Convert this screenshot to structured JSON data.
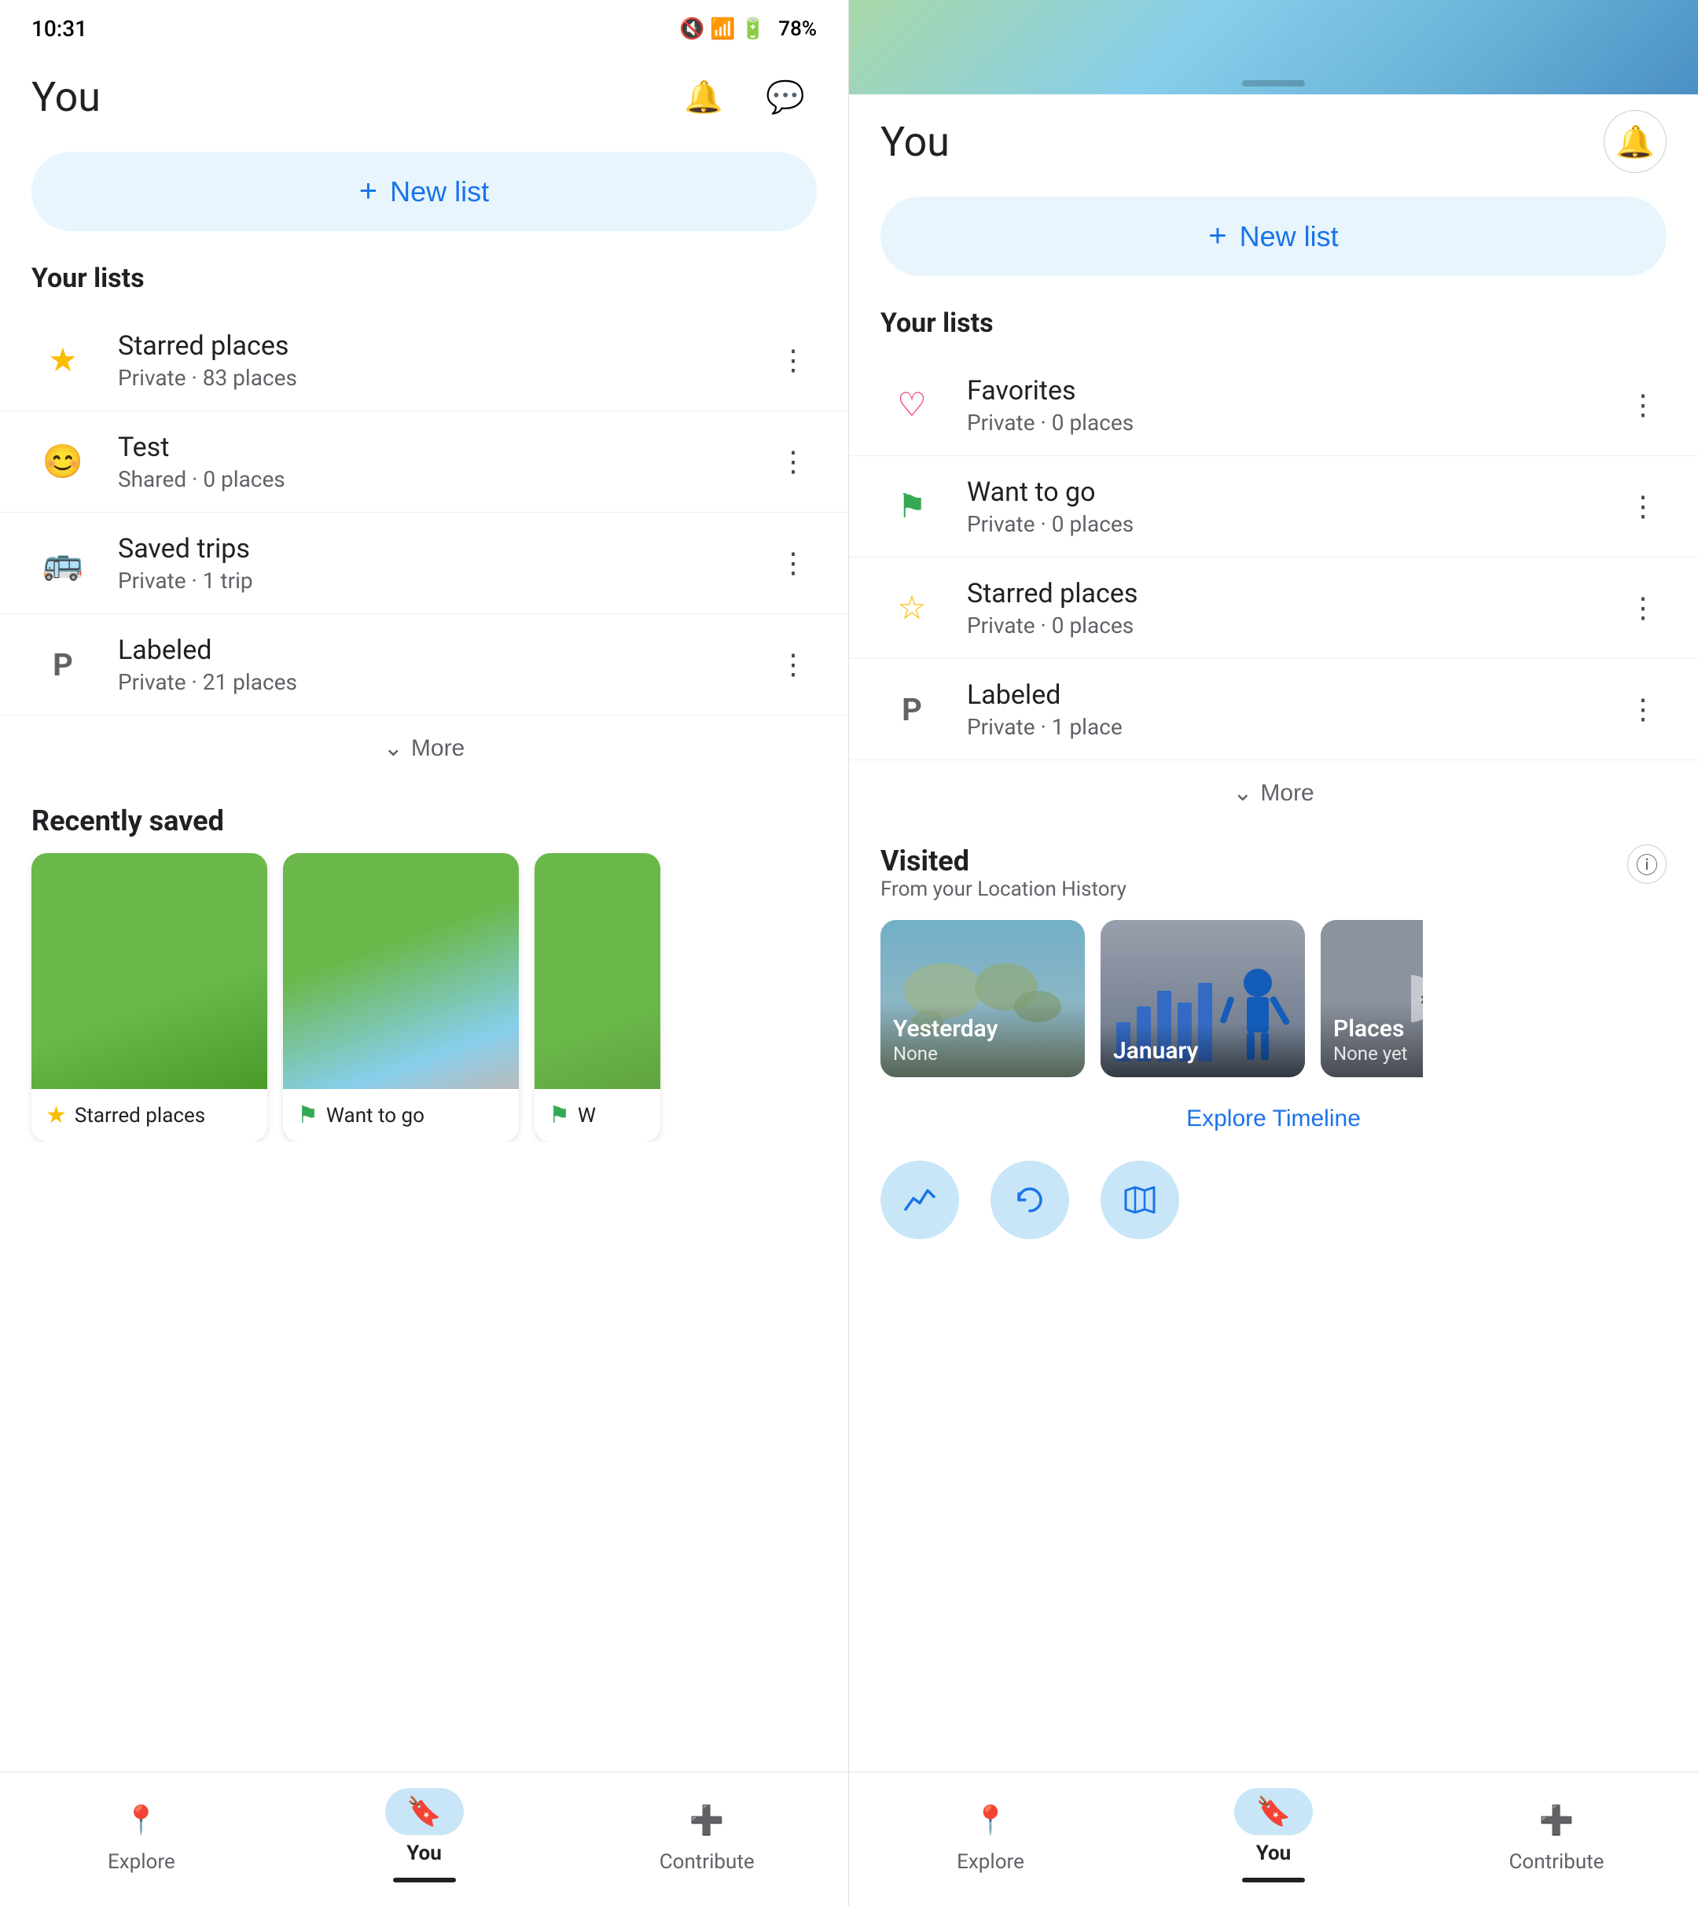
{
  "left": {
    "statusBar": {
      "time": "10:31",
      "battery": "78%"
    },
    "header": {
      "title": "You",
      "notificationIcon": "🔔",
      "messageIcon": "💬"
    },
    "newListBtn": {
      "label": "New list",
      "plusIcon": "+"
    },
    "yourLists": {
      "title": "Your lists",
      "items": [
        {
          "name": "Starred places",
          "sub": "Private · 83 places",
          "iconType": "star"
        },
        {
          "name": "Test",
          "sub": "Shared · 0 places",
          "iconType": "smiley"
        },
        {
          "name": "Saved trips",
          "sub": "Private · 1 trip",
          "iconType": "bus"
        },
        {
          "name": "Labeled",
          "sub": "Private · 21 places",
          "iconType": "label"
        }
      ],
      "moreBtn": "More"
    },
    "recentlySaved": {
      "title": "Recently saved",
      "cards": [
        {
          "label": "Starred places",
          "iconType": "star"
        },
        {
          "label": "Want to go",
          "iconType": "flag"
        },
        {
          "label": "W...",
          "iconType": "flag"
        }
      ]
    },
    "bottomNav": {
      "items": [
        {
          "label": "Explore",
          "icon": "📍",
          "active": false
        },
        {
          "label": "You",
          "icon": "🔖",
          "active": true
        },
        {
          "label": "Contribute",
          "icon": "➕",
          "active": false
        }
      ]
    }
  },
  "right": {
    "header": {
      "title": "You",
      "notificationIcon": "🔔"
    },
    "newListBtn": {
      "label": "New list",
      "plusIcon": "+"
    },
    "yourLists": {
      "title": "Your lists",
      "items": [
        {
          "name": "Favorites",
          "sub": "Private · 0 places",
          "iconType": "heart"
        },
        {
          "name": "Want to go",
          "sub": "Private · 0 places",
          "iconType": "flag"
        },
        {
          "name": "Starred places",
          "sub": "Private · 0 places",
          "iconType": "star"
        },
        {
          "name": "Labeled",
          "sub": "Private · 1 place",
          "iconType": "label"
        }
      ],
      "moreBtn": "More"
    },
    "visited": {
      "title": "Visited",
      "sub": "From your Location History",
      "cards": [
        {
          "title": "Yesterday",
          "sub": "None",
          "type": "world"
        },
        {
          "title": "January",
          "sub": "",
          "type": "bar"
        },
        {
          "title": "Places",
          "sub": "None yet",
          "type": "partial"
        }
      ],
      "exploreTimeline": "Explore Timeline"
    },
    "miniIcons": [
      "〜",
      "🔄",
      "🗺"
    ],
    "bottomNav": {
      "items": [
        {
          "label": "Explore",
          "icon": "📍",
          "active": false
        },
        {
          "label": "You",
          "icon": "🔖",
          "active": true
        },
        {
          "label": "Contribute",
          "icon": "➕",
          "active": false
        }
      ]
    }
  }
}
